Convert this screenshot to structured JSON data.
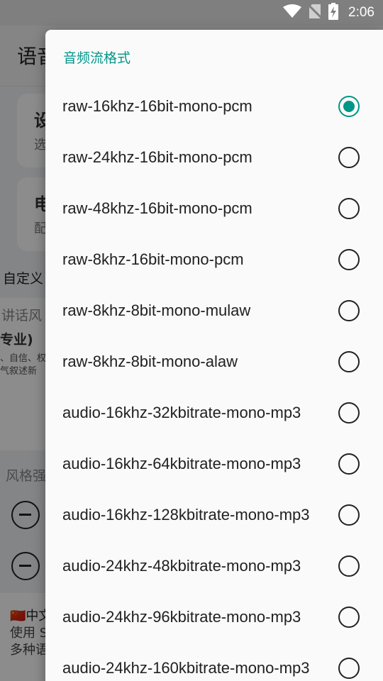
{
  "status_bar": {
    "time": "2:06",
    "icons": [
      "wifi-icon",
      "no-sim-icon",
      "battery-charging-icon"
    ]
  },
  "background": {
    "app_title": "语音",
    "card1": {
      "title": "设",
      "subtitle": "选"
    },
    "card2": {
      "title": "电",
      "subtitle": "配"
    },
    "custom_label": "自定义",
    "speaking_style_label": "讲话风",
    "style_name": "专业)",
    "style_desc_line1": "、自信、权",
    "style_desc_line2": "气叙述新",
    "style_intensity_label": "风格强",
    "lang_line1": "🇨🇳中文",
    "lang_line2": "使用 S",
    "lang_line3": "多种语"
  },
  "dialog": {
    "title": "音频流格式",
    "selected_index": 0,
    "options": [
      "raw-16khz-16bit-mono-pcm",
      "raw-24khz-16bit-mono-pcm",
      "raw-48khz-16bit-mono-pcm",
      "raw-8khz-16bit-mono-pcm",
      "raw-8khz-8bit-mono-mulaw",
      "raw-8khz-8bit-mono-alaw",
      "audio-16khz-32kbitrate-mono-mp3",
      "audio-16khz-64kbitrate-mono-mp3",
      "audio-16khz-128kbitrate-mono-mp3",
      "audio-24khz-48kbitrate-mono-mp3",
      "audio-24khz-96kbitrate-mono-mp3",
      "audio-24khz-160kbitrate-mono-mp3"
    ]
  },
  "colors": {
    "accent": "#009688",
    "title_accent": "#00968a",
    "scrim": "#000000"
  }
}
